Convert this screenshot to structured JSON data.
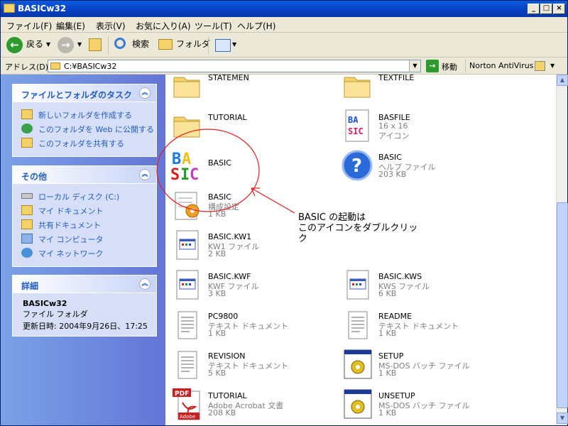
{
  "window": {
    "title": "BASICw32"
  },
  "menu": [
    "ファイル(F)",
    "編集(E)",
    "表示(V)",
    "お気に入り(A)",
    "ツール(T)",
    "ヘルプ(H)"
  ],
  "toolbar": {
    "back": "戻る",
    "search": "検索",
    "folders": "フォルダ"
  },
  "address": {
    "label": "アドレス(D)",
    "value": "C:¥BASICw32",
    "go": "移動",
    "norton": "Norton AntiVirus"
  },
  "tasks": {
    "title": "ファイルとフォルダのタスク",
    "items": [
      "新しいフォルダを作成する",
      "このフォルダを Web に公開する",
      "このフォルダを共有する"
    ]
  },
  "other": {
    "title": "その他",
    "items": [
      "ローカル ディスク (C:)",
      "マイ ドキュメント",
      "共有ドキュメント",
      "マイ コンピュータ",
      "マイ ネットワーク"
    ]
  },
  "details": {
    "title": "詳細",
    "name": "BASICw32",
    "type": "ファイル フォルダ",
    "date": "更新日時: 2004年9月26日、17:25"
  },
  "files": [
    {
      "name": "STATEMEN",
      "l1": "",
      "l2": "",
      "icon": "folder-icon"
    },
    {
      "name": "TEXTFILE",
      "l1": "",
      "l2": "",
      "icon": "folder-icon"
    },
    {
      "name": "TUTORIAL",
      "l1": "",
      "l2": "",
      "icon": "folder-icon"
    },
    {
      "name": "BASFILE",
      "l1": "16 x 16",
      "l2": "アイコン",
      "icon": "basic-icon"
    },
    {
      "name": "BASIC",
      "l1": "",
      "l2": "",
      "icon": "basic-icon"
    },
    {
      "name": "BASIC",
      "l1": "ヘルプ ファイル",
      "l2": "203 KB",
      "icon": "help-icon"
    },
    {
      "name": "BASIC",
      "l1": "構成設定",
      "l2": "1 KB",
      "icon": "config-icon"
    },
    {
      "name": "BASIC.KW1",
      "l1": "KW1 ファイル",
      "l2": "2 KB",
      "icon": "generic-file-icon"
    },
    {
      "name": "BASIC.KWF",
      "l1": "KWF ファイル",
      "l2": "3 KB",
      "icon": "generic-file-icon"
    },
    {
      "name": "BASIC.KWS",
      "l1": "KWS ファイル",
      "l2": "6 KB",
      "icon": "generic-file-icon"
    },
    {
      "name": "PC9800",
      "l1": "テキスト ドキュメント",
      "l2": "1 KB",
      "icon": "text-file-icon"
    },
    {
      "name": "README",
      "l1": "テキスト ドキュメント",
      "l2": "1 KB",
      "icon": "text-file-icon"
    },
    {
      "name": "REVISION",
      "l1": "テキスト ドキュメント",
      "l2": "5 KB",
      "icon": "text-file-icon"
    },
    {
      "name": "SETUP",
      "l1": "MS-DOS バッチ ファイル",
      "l2": "1 KB",
      "icon": "batch-file-icon"
    },
    {
      "name": "TUTORIAL",
      "l1": "Adobe Acrobat 文書",
      "l2": "208 KB",
      "icon": "pdf-icon"
    },
    {
      "name": "UNSETUP",
      "l1": "MS-DOS バッチ ファイル",
      "l2": "1 KB",
      "icon": "batch-file-icon"
    }
  ],
  "annotation": {
    "line1": "BASIC の起動は",
    "line2": "このアイコンをダブルクリッ",
    "line3": "ク"
  }
}
